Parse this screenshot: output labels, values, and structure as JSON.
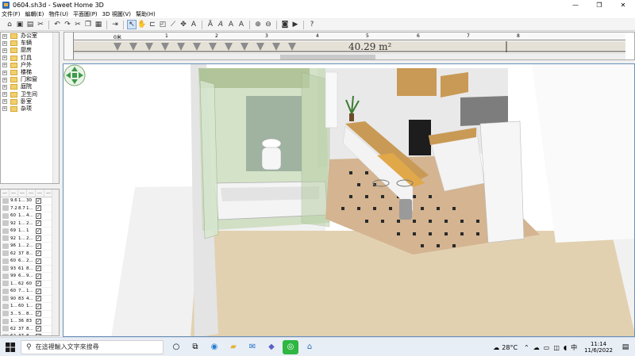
{
  "window": {
    "title": "0604.sh3d - Sweet Home 3D",
    "controls": [
      "—",
      "❐",
      "✕"
    ]
  },
  "menu": [
    "文件(F)",
    "編輯(E)",
    "物件(U)",
    "平面圖(P)",
    "3D 視圖(V)",
    "幫助(H)"
  ],
  "toolbar_icons": [
    "new-home",
    "open",
    "save",
    "cut",
    "undo",
    "redo",
    "cut2",
    "copy",
    "paste",
    "add-furniture",
    "select",
    "pan",
    "create-walls",
    "create-rooms",
    "create-polylines",
    "create-dimensions",
    "create-labels",
    "text-bold",
    "text-italic",
    "text-larger",
    "text-smaller",
    "zoom-in",
    "zoom-out",
    "create-photo",
    "create-video",
    "help"
  ],
  "catalog": {
    "categories": [
      "办公室",
      "车辆",
      "厨房",
      "灯具",
      "户外",
      "楼梯",
      "门和窗",
      "庭院",
      "卫生间",
      "卧室",
      "杂项"
    ]
  },
  "furniture_list": {
    "headers": [
      "...",
      "...",
      "...",
      "...",
      "...",
      "..."
    ],
    "rows": [
      [
        "9.6",
        "1...",
        "30",
        "✓"
      ],
      [
        "7.2",
        "8.7",
        "1...",
        "✓"
      ],
      [
        "60",
        "1...",
        "4...",
        "✓"
      ],
      [
        "92",
        "1...",
        "2...",
        "✓"
      ],
      [
        "69",
        "1...",
        "1",
        "✓"
      ],
      [
        "92",
        "1...",
        "2...",
        "✓"
      ],
      [
        "96",
        "1...",
        "2...",
        "✓"
      ],
      [
        "62",
        "37",
        "8...",
        "✓"
      ],
      [
        "60",
        "6...",
        "2...",
        "✓"
      ],
      [
        "93",
        "61",
        "8...",
        "✓"
      ],
      [
        "99",
        "6...",
        "9...",
        "✓"
      ],
      [
        "1...",
        "62",
        "60",
        "✓"
      ],
      [
        "60",
        "7...",
        "1...",
        "✓"
      ],
      [
        "90",
        "83",
        "4...",
        "✓"
      ],
      [
        "1...",
        "60",
        "1...",
        "✓"
      ],
      [
        "3...",
        "5...",
        "8...",
        "✓"
      ],
      [
        "1...",
        "36",
        "83",
        "✓"
      ],
      [
        "62",
        "37",
        "8...",
        "✓"
      ],
      [
        "62",
        "37",
        "8...",
        "✓"
      ]
    ]
  },
  "plan": {
    "ruler_labels": [
      "0米",
      "1",
      "2",
      "3",
      "4",
      "5",
      "6",
      "7",
      "8"
    ],
    "area_label": "40.29 m²"
  },
  "taskbar": {
    "search_placeholder": "在這裡輸入文字來搜尋",
    "weather": "28°C",
    "time": "11:14",
    "date": "11/6/2022"
  },
  "colors": {
    "floor_tile": "#d4b491",
    "floor_dark": "#2a2a2a",
    "glass": "#b7cfa0",
    "cabinet": "#f2f2f2",
    "wood": "#c99a55",
    "sky": "#ffffff",
    "view_border": "#6a8fb9"
  }
}
